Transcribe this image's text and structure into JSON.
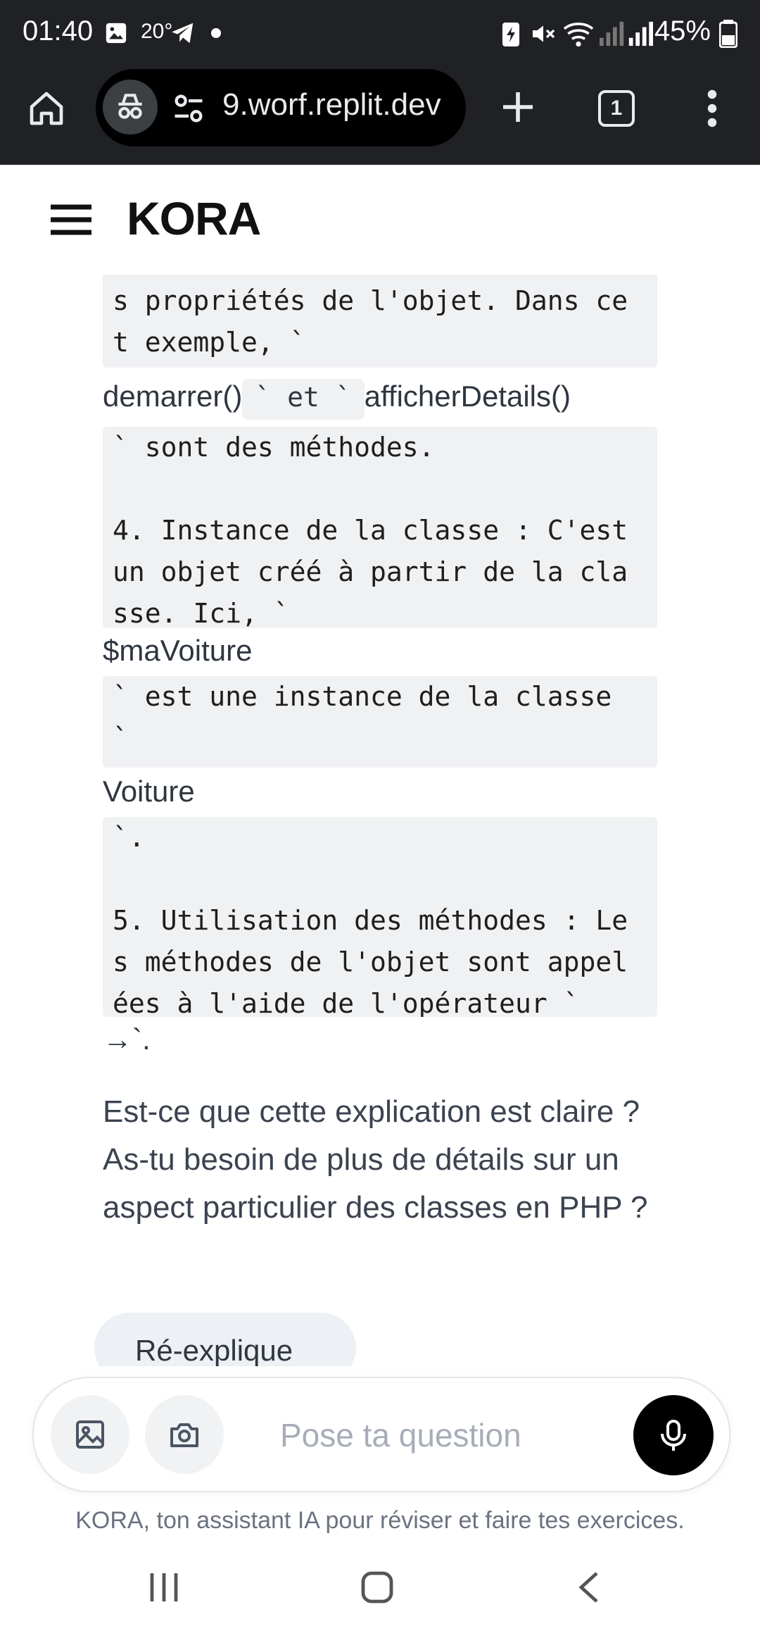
{
  "status_bar": {
    "time": "01:40",
    "temperature": "20°",
    "battery": "45%"
  },
  "browser": {
    "url": "9.worf.replit.dev",
    "tab_count": "1"
  },
  "app": {
    "brand": "KORA"
  },
  "content": {
    "code1": "s propriétés de l'objet. Dans ce\nt exemple, `",
    "method1": "demarrer()",
    "inline_et": "` et `",
    "method2": "afficherDetails()",
    "code2": "` sont des méthodes.\n\n4. Instance de la classe : C'est\nun objet créé à partir de la cla\nsse. Ici, `",
    "var_name": "$maVoiture",
    "code3": "` est une instance de la classe\n`",
    "class_name": "Voiture",
    "code4": "`.\n\n5. Utilisation des méthodes : Le\ns méthodes de l'objet sont appel\nées à l'aide de l'opérateur `",
    "arrow": "→`.",
    "question": "Est-ce que cette explication est claire ? As-tu besoin de plus de détails sur un aspect particulier des classes en PHP ?",
    "chip_label": "Ré-explique"
  },
  "composer": {
    "placeholder": "Pose ta question"
  },
  "footer": {
    "text": "KORA, ton assistant IA pour réviser et faire tes exercices."
  },
  "icons": {
    "status": [
      "gallery-icon",
      "telegram-icon",
      "dot-icon",
      "battery-saver-icon",
      "mute-icon",
      "wifi-icon",
      "signal-icon",
      "battery-icon"
    ],
    "browser": [
      "home-icon",
      "incognito-icon",
      "site-settings-icon",
      "new-tab-icon",
      "tab-switcher-icon",
      "more-vert-icon"
    ],
    "app": [
      "menu-icon",
      "image-icon",
      "camera-icon",
      "mic-icon"
    ],
    "nav": [
      "recents-icon",
      "home-nav-icon",
      "back-icon"
    ]
  }
}
